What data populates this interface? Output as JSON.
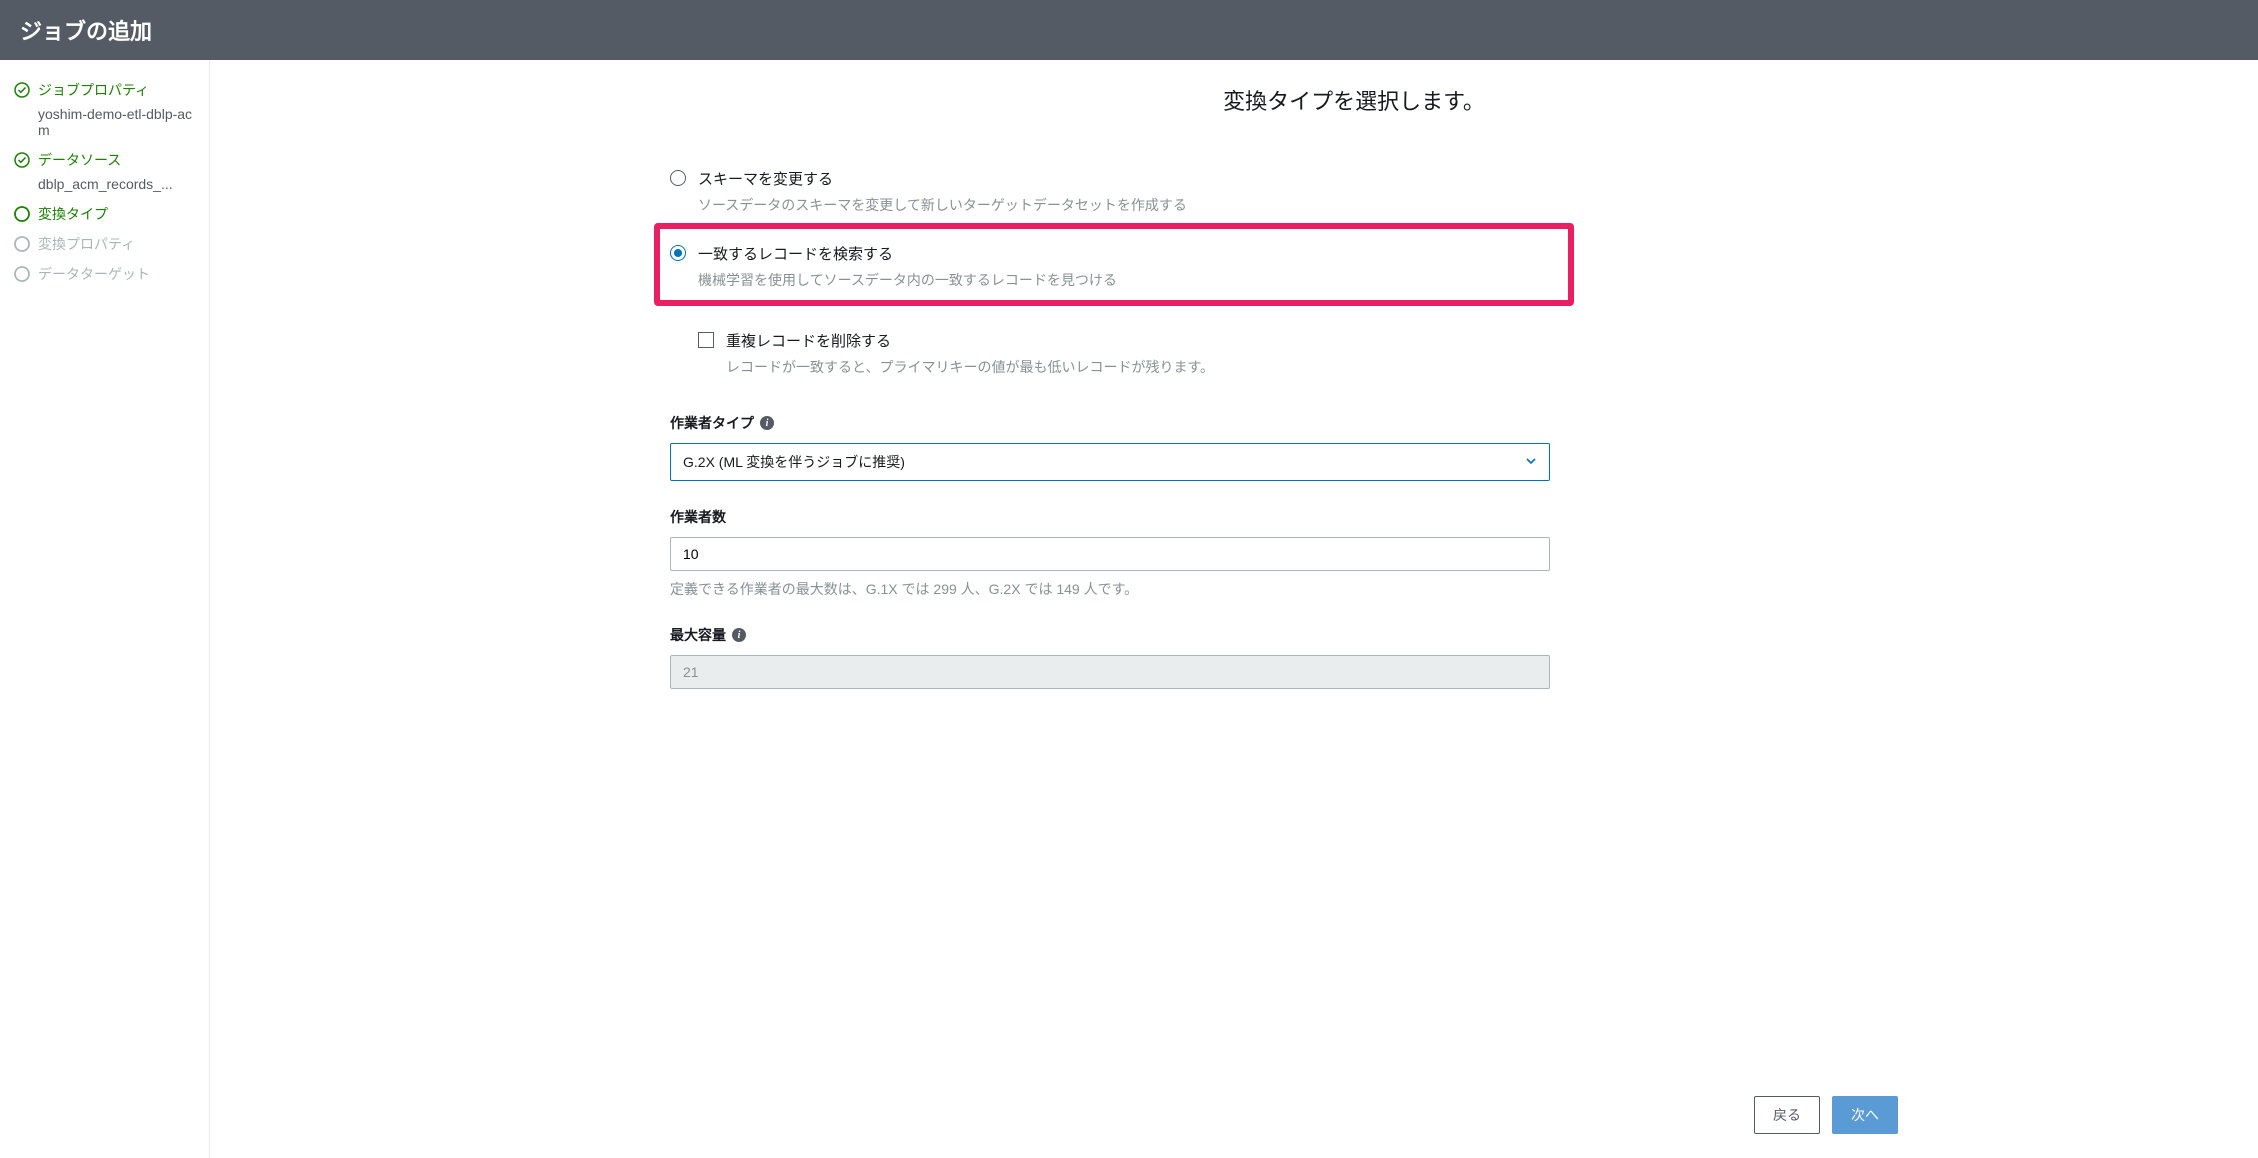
{
  "header": {
    "title": "ジョブの追加"
  },
  "sidebar": {
    "steps": [
      {
        "label": "ジョブプロパティ",
        "sub": "yoshim-demo-etl-dblp-acm",
        "state": "done"
      },
      {
        "label": "データソース",
        "sub": "dblp_acm_records_...",
        "state": "done"
      },
      {
        "label": "変換タイプ",
        "state": "current"
      },
      {
        "label": "変換プロパティ",
        "state": "disabled"
      },
      {
        "label": "データターゲット",
        "state": "disabled"
      }
    ]
  },
  "main": {
    "title": "変換タイプを選択します。",
    "radios": [
      {
        "title": "スキーマを変更する",
        "desc": "ソースデータのスキーマを変更して新しいターゲットデータセットを作成する",
        "selected": false
      },
      {
        "title": "一致するレコードを検索する",
        "desc": "機械学習を使用してソースデータ内の一致するレコードを見つける",
        "selected": true,
        "highlighted": true
      }
    ],
    "checkbox": {
      "title": "重複レコードを削除する",
      "desc": "レコードが一致すると、プライマリキーの値が最も低いレコードが残ります。",
      "checked": false
    },
    "worker_type": {
      "label": "作業者タイプ",
      "value": "G.2X (ML 変換を伴うジョブに推奨)"
    },
    "worker_count": {
      "label": "作業者数",
      "value": "10",
      "help": "定義できる作業者の最大数は、G.1X では 299 人、G.2X では 149 人です。"
    },
    "max_capacity": {
      "label": "最大容量",
      "value": "21"
    },
    "buttons": {
      "back": "戻る",
      "next": "次へ"
    }
  }
}
